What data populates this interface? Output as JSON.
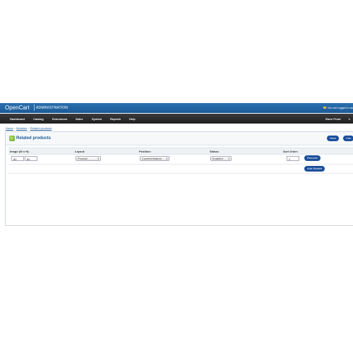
{
  "header": {
    "brand": "OpenCart",
    "admin_label": "ADMINISTRATION",
    "logged_in": "You are logged in as"
  },
  "menu": {
    "items": [
      "Dashboard",
      "Catalog",
      "Extensions",
      "Sales",
      "System",
      "Reports",
      "Help"
    ],
    "right_items": [
      "Store Front",
      "L"
    ]
  },
  "breadcrumb": {
    "home": "Home",
    "sep": "::",
    "modules": "Modules",
    "current": "Related products"
  },
  "page": {
    "title": "Related products",
    "save_label": "Save",
    "cancel_label": "Can"
  },
  "table": {
    "headers": [
      "Image (W x H):",
      "Layout:",
      "Position:",
      "Status:",
      "Sort Order:"
    ],
    "row": {
      "width": "80",
      "height": "80",
      "layout": "Product",
      "position": "Content Bottom",
      "status": "Enabled",
      "sort_order": "2",
      "remove_label": "Remove"
    },
    "add_module_label": "Add Module"
  },
  "colors": {
    "topbar": "#1b5a96",
    "menubar": "#2a2a2a",
    "button": "#1b4f9c",
    "link": "#1b5a96"
  }
}
